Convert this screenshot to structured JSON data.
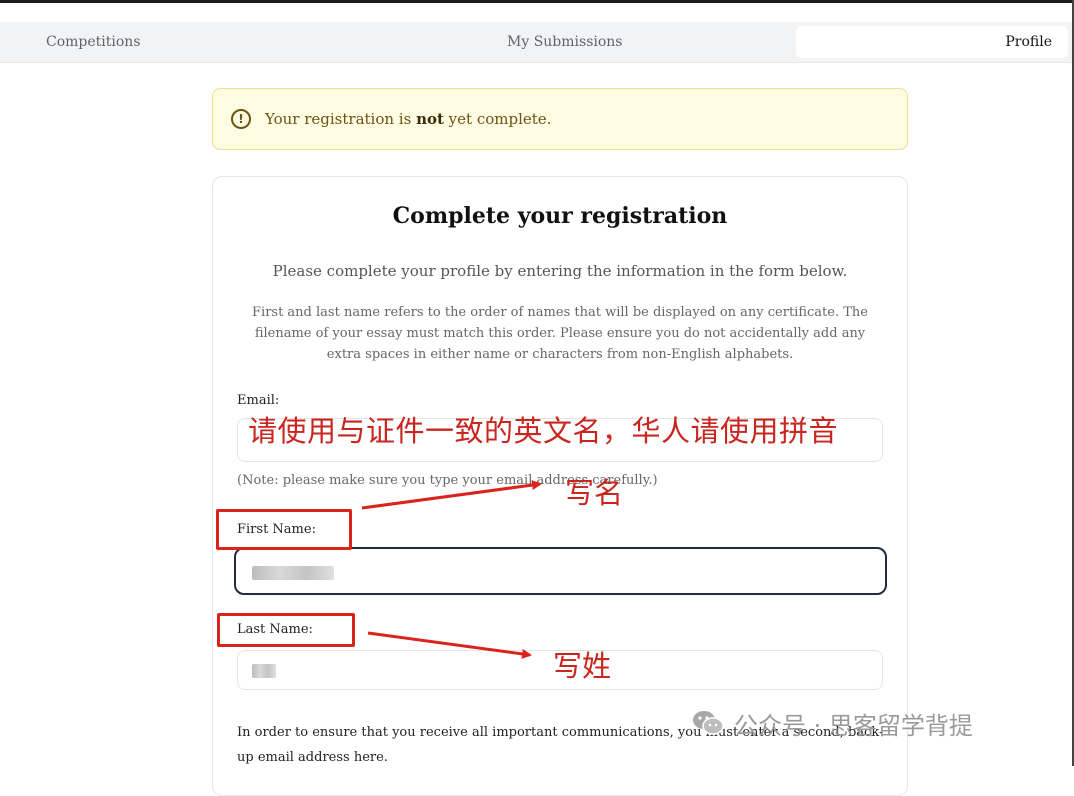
{
  "nav": {
    "tabs": [
      {
        "label": "Competitions"
      },
      {
        "label": "My Submissions"
      },
      {
        "label": "Profile"
      }
    ]
  },
  "alert": {
    "icon": "exclamation-circle-icon",
    "text_before": "Your registration is ",
    "text_strong": "not",
    "text_after": " yet complete."
  },
  "form": {
    "title": "Complete your registration",
    "subtitle": "Please complete your profile by entering the information in the form below.",
    "note": "First and last name refers to the order of names that will be displayed on any certificate. The filename of your essay must match this order. Please ensure you do not accidentally add any extra spaces in either name or characters from non-English alphabets.",
    "email_label": "Email:",
    "email_note": "(Note: please make sure you type your email address carefully.)",
    "first_name_label": "First Name:",
    "last_name_label": "Last Name:",
    "backup_email_text": "In order to ensure that you receive all important communications, you must enter a second, back-up email address here."
  },
  "annotations": {
    "main": "请使用与证件一致的英文名，华人请使用拼音",
    "given_name": "写名",
    "surname": "写姓",
    "color": "#c8261f"
  },
  "watermark": {
    "icon": "wechat-icon",
    "text": "公众号 · 思客留学背提"
  }
}
